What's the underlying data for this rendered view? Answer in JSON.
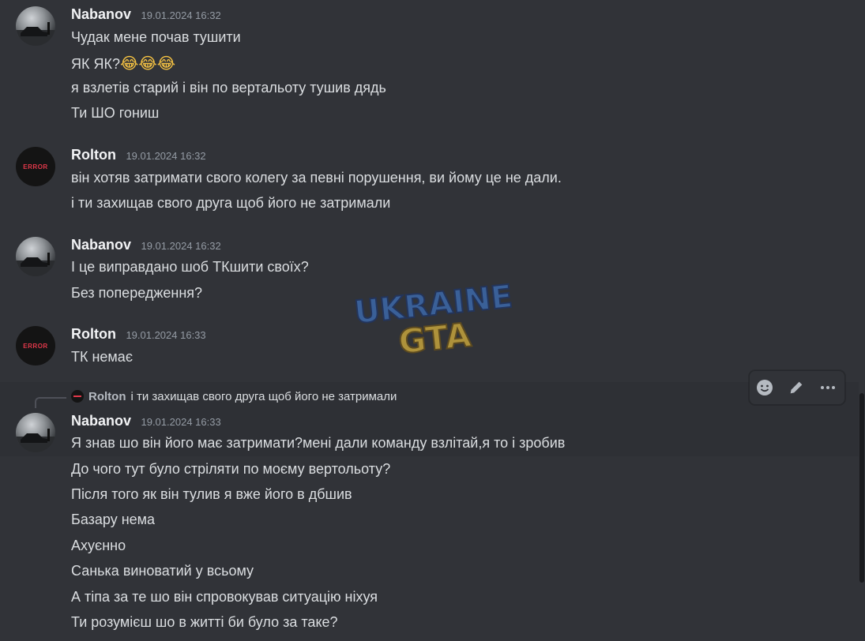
{
  "messages": [
    {
      "username": "Nabanov",
      "timestamp": "19.01.2024 16:32",
      "lines": [
        "Чудак мене почав тушити",
        "ЯК ЯК?",
        "я взлетів старий і він по вертальоту тушив дядь",
        "Ти ШО гониш"
      ],
      "emoji": "😂😂😂"
    },
    {
      "username": "Rolton",
      "timestamp": "19.01.2024 16:32",
      "lines": [
        "він хотяв затримати свого колегу за певні порушення, ви йому це не дали.",
        "і ти захищав свого друга щоб його не затримали"
      ]
    },
    {
      "username": "Nabanov",
      "timestamp": "19.01.2024 16:32",
      "lines": [
        "І це виправдано шоб ТКшити своїх?",
        "Без попередження?"
      ]
    },
    {
      "username": "Rolton",
      "timestamp": "19.01.2024 16:33",
      "lines": [
        "ТК немає"
      ]
    },
    {
      "reply": {
        "username": "Rolton",
        "text": "і ти захищав свого друга щоб його не затримали"
      },
      "username": "Nabanov",
      "timestamp": "19.01.2024 16:33",
      "lines": [
        "Я знав шо він його має затримати?мені дали команду взлітай,я то і зробив",
        "До чого тут було стріляти по моєму вертольоту?",
        "Після того як він тулив я вже його в дбшив",
        "Базару нема",
        "Ахуєнно",
        "Санька виноватий у всьому",
        "А тіпа за те шо він спровокував ситуацію ніхуя",
        "Ти розумієш шо в житті би було за таке?"
      ]
    }
  ],
  "avatars": {
    "error_label": "ERROR"
  },
  "watermark": {
    "line1": "UKRAINE",
    "line2": "GTA"
  },
  "toolbar": {
    "icons": [
      "add-reaction-icon",
      "edit-icon",
      "more-icon"
    ]
  },
  "colors": {
    "background": "#313338",
    "username": "#f2f3f5",
    "text": "#dbdee1",
    "timestamp": "#949ba4",
    "error_red": "#e2384a"
  }
}
